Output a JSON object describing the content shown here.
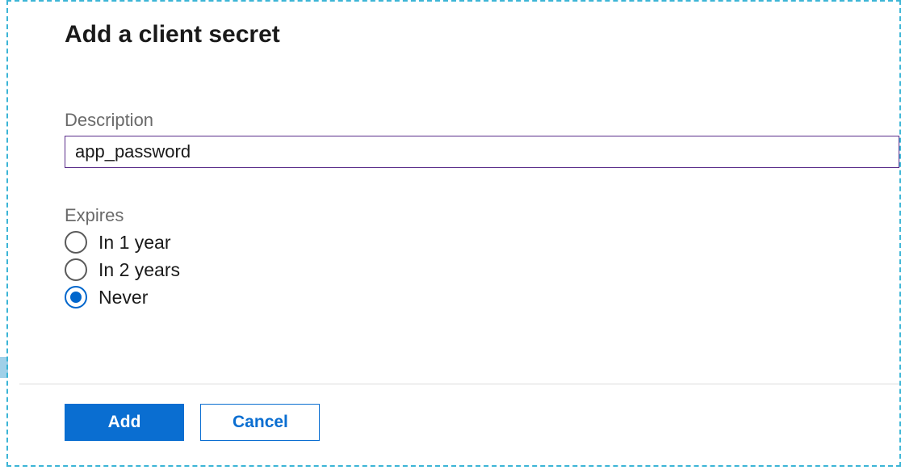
{
  "panel": {
    "title": "Add a client secret",
    "description": {
      "label": "Description",
      "value": "app_password"
    },
    "expires": {
      "label": "Expires",
      "options": [
        {
          "label": "In 1 year",
          "selected": false
        },
        {
          "label": "In 2 years",
          "selected": false
        },
        {
          "label": "Never",
          "selected": true
        }
      ]
    }
  },
  "footer": {
    "add_label": "Add",
    "cancel_label": "Cancel"
  },
  "colors": {
    "dashed_border": "#3cb5d6",
    "primary_button": "#0a6ed1",
    "input_border": "#5a2d8a"
  }
}
